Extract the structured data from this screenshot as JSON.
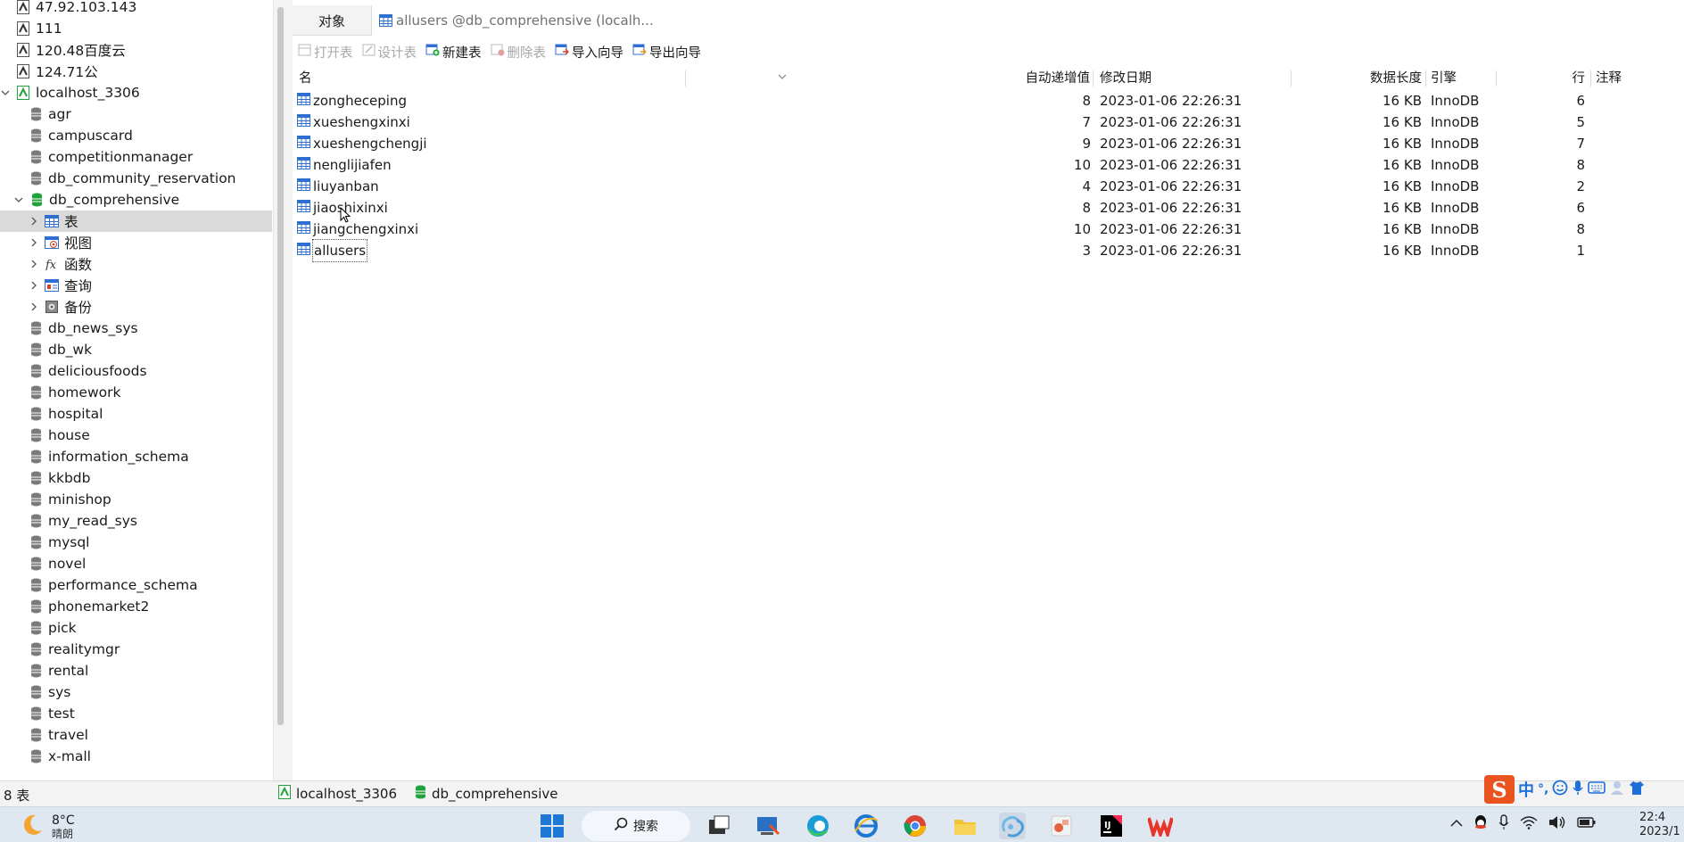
{
  "sidebar": {
    "connections_top": [
      {
        "label": "47.92.103.143"
      },
      {
        "label": "111"
      },
      {
        "label": "120.48百度云"
      },
      {
        "label": "124.71公"
      }
    ],
    "local_connection": {
      "label": "localhost_3306"
    },
    "databases_before": [
      {
        "label": "agr"
      },
      {
        "label": "campuscard"
      },
      {
        "label": "competitionmanager"
      },
      {
        "label": "db_community_reservation"
      }
    ],
    "open_database": {
      "label": "db_comprehensive"
    },
    "open_database_children": [
      {
        "label": "表",
        "icon": "table-icon"
      },
      {
        "label": "视图",
        "icon": "view-icon"
      },
      {
        "label": "函数",
        "icon": "function-icon"
      },
      {
        "label": "查询",
        "icon": "query-icon"
      },
      {
        "label": "备份",
        "icon": "backup-icon"
      }
    ],
    "databases_after": [
      {
        "label": "db_news_sys"
      },
      {
        "label": "db_wk"
      },
      {
        "label": "deliciousfoods"
      },
      {
        "label": "homework"
      },
      {
        "label": "hospital"
      },
      {
        "label": "house"
      },
      {
        "label": "information_schema"
      },
      {
        "label": "kkbdb"
      },
      {
        "label": "minishop"
      },
      {
        "label": "my_read_sys"
      },
      {
        "label": "mysql"
      },
      {
        "label": "novel"
      },
      {
        "label": "performance_schema"
      },
      {
        "label": "phonemarket2"
      },
      {
        "label": "pick"
      },
      {
        "label": "realitymgr"
      },
      {
        "label": "rental"
      },
      {
        "label": "sys"
      },
      {
        "label": "test"
      },
      {
        "label": "travel"
      },
      {
        "label": "x-mall"
      }
    ]
  },
  "tabs": {
    "objects_label": "对象",
    "active_label": "allusers @db_comprehensive (localh..."
  },
  "toolbar": {
    "open_table": "打开表",
    "design_table": "设计表",
    "new_table": "新建表",
    "delete_table": "删除表",
    "import_wizard": "导入向导",
    "export_wizard": "导出向导"
  },
  "table": {
    "headers": {
      "name": "名",
      "auto_inc": "自动递增值",
      "modified": "修改日期",
      "data_length": "数据长度",
      "engine": "引擎",
      "rows": "行",
      "comment": "注释"
    },
    "rows": [
      {
        "name": "zongheceping",
        "auto_inc": "8",
        "modified": "2023-01-06 22:26:31",
        "data_length": "16 KB",
        "engine": "InnoDB",
        "rows": "6"
      },
      {
        "name": "xueshengxinxi",
        "auto_inc": "7",
        "modified": "2023-01-06 22:26:31",
        "data_length": "16 KB",
        "engine": "InnoDB",
        "rows": "5"
      },
      {
        "name": "xueshengchengji",
        "auto_inc": "9",
        "modified": "2023-01-06 22:26:31",
        "data_length": "16 KB",
        "engine": "InnoDB",
        "rows": "7"
      },
      {
        "name": "nenglijiafen",
        "auto_inc": "10",
        "modified": "2023-01-06 22:26:31",
        "data_length": "16 KB",
        "engine": "InnoDB",
        "rows": "8"
      },
      {
        "name": "liuyanban",
        "auto_inc": "4",
        "modified": "2023-01-06 22:26:31",
        "data_length": "16 KB",
        "engine": "InnoDB",
        "rows": "2"
      },
      {
        "name": "jiaoshixinxi",
        "auto_inc": "8",
        "modified": "2023-01-06 22:26:31",
        "data_length": "16 KB",
        "engine": "InnoDB",
        "rows": "6"
      },
      {
        "name": "jiangchengxinxi",
        "auto_inc": "10",
        "modified": "2023-01-06 22:26:31",
        "data_length": "16 KB",
        "engine": "InnoDB",
        "rows": "8"
      },
      {
        "name": "allusers",
        "auto_inc": "3",
        "modified": "2023-01-06 22:26:31",
        "data_length": "16 KB",
        "engine": "InnoDB",
        "rows": "1"
      }
    ]
  },
  "statusbar": {
    "count": "8 表",
    "connection": "localhost_3306",
    "database": "db_comprehensive"
  },
  "ime": {
    "chinese": "中",
    "punct": "°,"
  },
  "taskbar": {
    "temperature": "8°C",
    "condition": "晴朗",
    "search_label": "搜索",
    "clock_time": "22:4",
    "clock_date": "2023/1"
  },
  "colors": {
    "accent_green": "#1fa33a",
    "accent_blue": "#2f6fd0",
    "selection": "#dadada"
  }
}
